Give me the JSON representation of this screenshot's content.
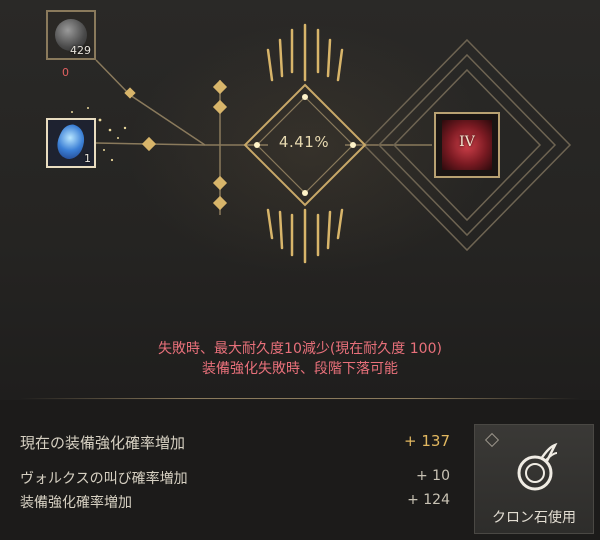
{
  "materials": {
    "stone": {
      "name": "stone-icon",
      "count": "429",
      "required": "0"
    },
    "crystal": {
      "name": "crystal-icon",
      "count": "1"
    }
  },
  "enhance": {
    "success_rate": "4.41%",
    "gear_tier": "IV"
  },
  "warnings": {
    "line1": "失敗時、最大耐久度10減少(現在耐久度 100)",
    "line2": "装備強化失敗時、段階下落可能"
  },
  "bonus": {
    "total_label": "現在の装備強化確率増加",
    "total_value": "+ 137",
    "items": [
      {
        "label": "ヴォルクスの叫び確率増加",
        "value": "+ 10"
      },
      {
        "label": "装備強化確率増加",
        "value": "+ 124"
      }
    ]
  },
  "actions": {
    "clone_stone_label": "クロン石使用"
  },
  "colors": {
    "gold": "#d8b56a",
    "warning": "#e8707a",
    "bonus_total": "#e2b860"
  }
}
